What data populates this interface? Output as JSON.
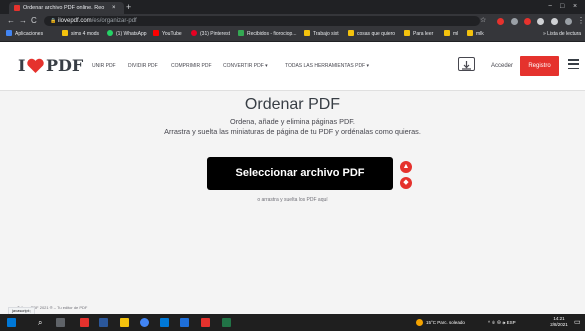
{
  "browser": {
    "tab_title": "Ordenar archivo PDF online. Reo",
    "tab_close": "×",
    "new_tab": "+",
    "window_controls": [
      "−",
      "□",
      "×"
    ],
    "nav_buttons": [
      "←",
      "→",
      "C"
    ],
    "url_host": "ilovepdf.com",
    "url_path": "/es/organizar-pdf",
    "bookmarks": [
      {
        "label": "Aplicaciones",
        "color": "#4285f4"
      },
      {
        "label": "sims 4 mods",
        "color": "#f4c20d"
      },
      {
        "label": "(1) WhatsApp",
        "color": "#25d366"
      },
      {
        "label": "YouTube",
        "color": "#ff0000"
      },
      {
        "label": "(31) Pinterest",
        "color": "#e60023"
      },
      {
        "label": "Recibidos - fiorociop...",
        "color": "#34a853"
      },
      {
        "label": "Trabajo sixt",
        "color": "#f4c20d"
      },
      {
        "label": "cosas que quiero",
        "color": "#f4c20d"
      },
      {
        "label": "Para leer",
        "color": "#f4c20d"
      },
      {
        "label": "ml",
        "color": "#f4c20d"
      },
      {
        "label": "mlk",
        "color": "#f4c20d"
      }
    ],
    "reading_list": "Lista de lectura",
    "status_url": "javascript:;"
  },
  "header": {
    "logo_left": "I",
    "logo_right": "PDF",
    "nav": [
      "UNIR PDF",
      "DIVIDIR PDF",
      "COMPRIMIR PDF",
      "CONVERTIR PDF ▾",
      "TODAS LAS HERRAMIENTAS PDF ▾"
    ],
    "login": "Acceder",
    "signup": "Registro"
  },
  "main": {
    "title": "Ordenar PDF",
    "subtitle_1": "Ordena, añade y elimina páginas PDF.",
    "subtitle_2": "Arrastra y suelta las miniaturas de página de tu PDF y ordénalas como quieras.",
    "select_button": "Seleccionar archivo PDF",
    "drop_hint": "o arrastra y suelta los PDF aquí"
  },
  "footer": {
    "copyright": "© iLovePDF 2021 ® – Tu editor de PDF"
  },
  "taskbar": {
    "weather": "15°C Parc. soleado",
    "tray": "^ ㅎ ⊕ 🕪 ESP",
    "time": "14:21",
    "date": "2/8/2021"
  },
  "colors": {
    "brand_red": "#e5322d",
    "text_dark": "#383e45",
    "page_bg": "#f4f4f4"
  }
}
